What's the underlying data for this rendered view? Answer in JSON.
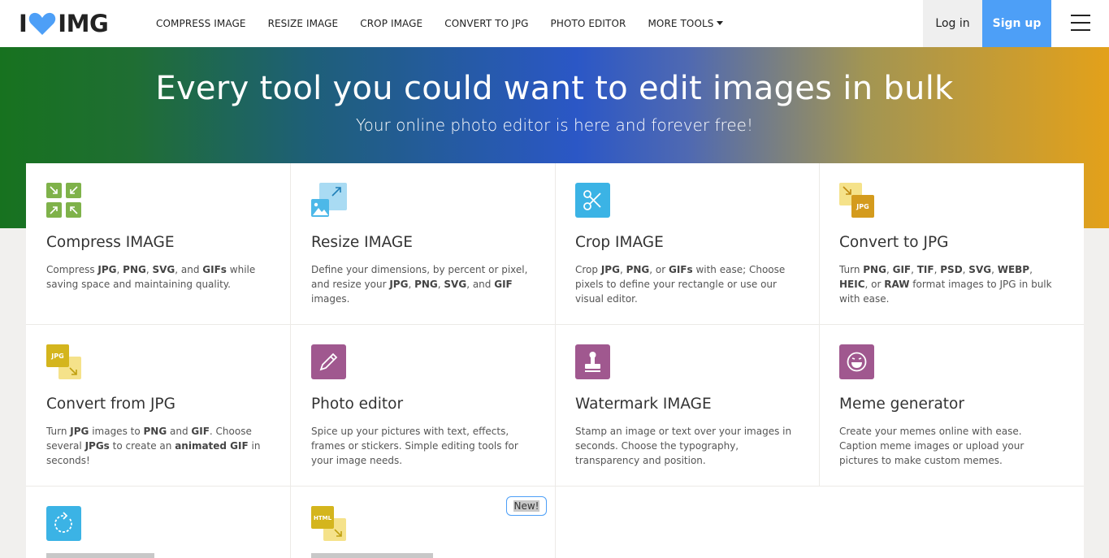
{
  "header": {
    "logo_left": "I",
    "logo_right": "IMG",
    "nav": [
      {
        "label": "COMPRESS IMAGE"
      },
      {
        "label": "RESIZE IMAGE"
      },
      {
        "label": "CROP IMAGE"
      },
      {
        "label": "CONVERT TO JPG"
      },
      {
        "label": "PHOTO EDITOR"
      },
      {
        "label": "MORE TOOLS"
      }
    ],
    "login_label": "Log in",
    "signup_label": "Sign up",
    "accent_color": "#4d9ff7"
  },
  "hero": {
    "title": "Every tool you could want to edit images in bulk",
    "subtitle": "Your online photo editor is here and forever free!"
  },
  "tools": [
    {
      "title": "Compress IMAGE",
      "icon": "compress-icon",
      "color": "#7fb24a",
      "desc": [
        [
          "Compress ",
          false
        ],
        [
          "JPG",
          true
        ],
        [
          ", ",
          false
        ],
        [
          "PNG",
          true
        ],
        [
          ", ",
          false
        ],
        [
          "SVG",
          true
        ],
        [
          ", and ",
          false
        ],
        [
          "GIFs",
          true
        ],
        [
          " while saving space and maintaining quality.",
          false
        ]
      ]
    },
    {
      "title": "Resize IMAGE",
      "icon": "resize-icon",
      "color": "#4db8e8",
      "desc": [
        [
          "Define your dimensions, by percent or pixel, and resize your ",
          false
        ],
        [
          "JPG",
          true
        ],
        [
          ", ",
          false
        ],
        [
          "PNG",
          true
        ],
        [
          ", ",
          false
        ],
        [
          "SVG",
          true
        ],
        [
          ", and ",
          false
        ],
        [
          "GIF",
          true
        ],
        [
          " images.",
          false
        ]
      ]
    },
    {
      "title": "Crop IMAGE",
      "icon": "scissors-icon",
      "color": "#3bb3e5",
      "desc": [
        [
          "Crop ",
          false
        ],
        [
          "JPG",
          true
        ],
        [
          ", ",
          false
        ],
        [
          "PNG",
          true
        ],
        [
          ", or ",
          false
        ],
        [
          "GIFs",
          true
        ],
        [
          " with ease; Choose pixels to define your rectangle or use our visual editor.",
          false
        ]
      ]
    },
    {
      "title": "Convert to JPG",
      "icon": "convert-to-jpg-icon",
      "color": "#d49b1d",
      "desc": [
        [
          "Turn ",
          false
        ],
        [
          "PNG",
          true
        ],
        [
          ", ",
          false
        ],
        [
          "GIF",
          true
        ],
        [
          ", ",
          false
        ],
        [
          "TIF",
          true
        ],
        [
          ", ",
          false
        ],
        [
          "PSD",
          true
        ],
        [
          ", ",
          false
        ],
        [
          "SVG",
          true
        ],
        [
          ", ",
          false
        ],
        [
          "WEBP",
          true
        ],
        [
          ", ",
          false
        ],
        [
          "HEIC",
          true
        ],
        [
          ", or ",
          false
        ],
        [
          "RAW",
          true
        ],
        [
          " format images to JPG in bulk with ease.",
          false
        ]
      ]
    },
    {
      "title": "Convert from JPG",
      "icon": "convert-from-jpg-icon",
      "color": "#d4b51d",
      "desc": [
        [
          "Turn ",
          false
        ],
        [
          "JPG",
          true
        ],
        [
          " images to ",
          false
        ],
        [
          "PNG",
          true
        ],
        [
          " and ",
          false
        ],
        [
          "GIF",
          true
        ],
        [
          ". Choose several ",
          false
        ],
        [
          "JPGs",
          true
        ],
        [
          " to create an ",
          false
        ],
        [
          "animated GIF",
          true
        ],
        [
          " in seconds!",
          false
        ]
      ]
    },
    {
      "title": "Photo editor",
      "icon": "pencil-icon",
      "color": "#a0588f",
      "desc": [
        [
          "Spice up your pictures with text, effects, frames or stickers. Simple editing tools for your image needs.",
          false
        ]
      ]
    },
    {
      "title": "Watermark IMAGE",
      "icon": "stamp-icon",
      "color": "#a0588f",
      "desc": [
        [
          "Stamp an image or text over your images in seconds. Choose the typography, transparency and position.",
          false
        ]
      ]
    },
    {
      "title": "Meme generator",
      "icon": "meme-face-icon",
      "color": "#a0588f",
      "desc": [
        [
          "Create your memes online with ease. Caption meme images or upload your pictures to make custom memes.",
          false
        ]
      ]
    },
    {
      "title": "",
      "icon": "rotate-icon",
      "color": "#3bb3e5",
      "desc": []
    },
    {
      "title": "",
      "icon": "html-to-image-icon",
      "color": "#d4b51d",
      "desc": [],
      "badge": "New!"
    }
  ]
}
